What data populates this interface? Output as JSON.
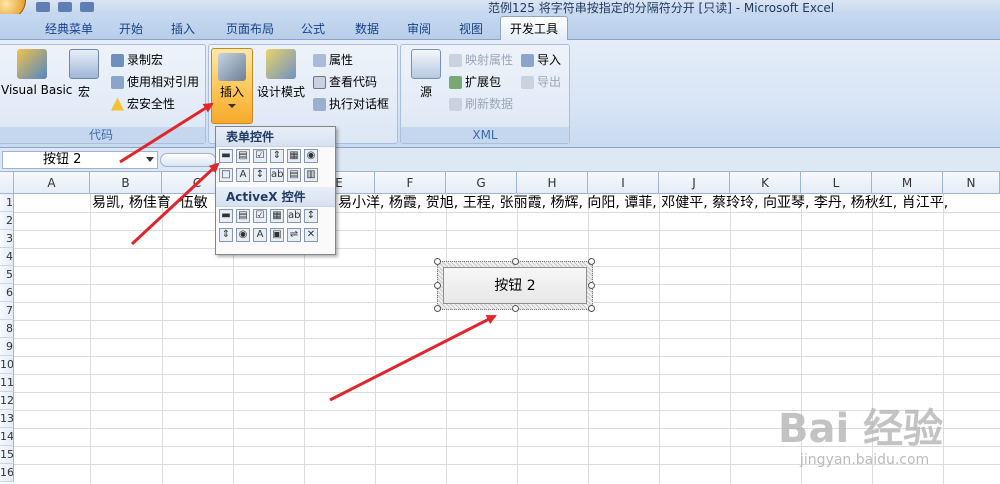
{
  "window": {
    "title": "范例125 将字符串按指定的分隔符分开 [只读] - Microsoft Excel"
  },
  "tabs": [
    "经典菜单",
    "开始",
    "插入",
    "页面布局",
    "公式",
    "数据",
    "审阅",
    "视图",
    "开发工具"
  ],
  "active_tab": "开发工具",
  "ribbon": {
    "code_group": {
      "label": "代码",
      "visual_basic": "Visual Basic",
      "macros": "宏",
      "record_macro": "录制宏",
      "relative_ref": "使用相对引用",
      "macro_security": "宏安全性"
    },
    "controls_group": {
      "insert": "插入",
      "design_mode": "设计模式",
      "properties": "属性",
      "view_code": "查看代码",
      "run_dialog": "执行对话框"
    },
    "xml_group": {
      "label": "XML",
      "source": "源",
      "map_properties": "映射属性",
      "expansion_packs": "扩展包",
      "refresh_data": "刷新数据",
      "import": "导入",
      "export": "导出"
    }
  },
  "insert_palette": {
    "form_controls_label": "表单控件",
    "activex_label": "ActiveX 控件"
  },
  "formula_bar": {
    "name_box": "按钮 2"
  },
  "sheet": {
    "columns": [
      "A",
      "B",
      "C",
      "D",
      "E",
      "F",
      "G",
      "H",
      "I",
      "J",
      "K",
      "L",
      "M",
      "N"
    ],
    "rows": [
      "1",
      "2",
      "3",
      "4",
      "5",
      "6",
      "7",
      "8",
      "9",
      "10",
      "11",
      "12",
      "13",
      "14",
      "15",
      "16"
    ],
    "b1_visible_left": "易凯, 杨佳育, 伍敏",
    "b1_visible_right": "易小洋, 杨霞, 贺旭, 王程, 张丽霞, 杨辉, 向阳, 谭菲, 邓健平, 蔡玲玲, 向亚琴, 李丹, 杨秋红, 肖江平,"
  },
  "sheet_button": {
    "label": "按钮 2"
  },
  "watermark": {
    "main": "Bai 经验",
    "sub": "jingyan.baidu.com"
  }
}
